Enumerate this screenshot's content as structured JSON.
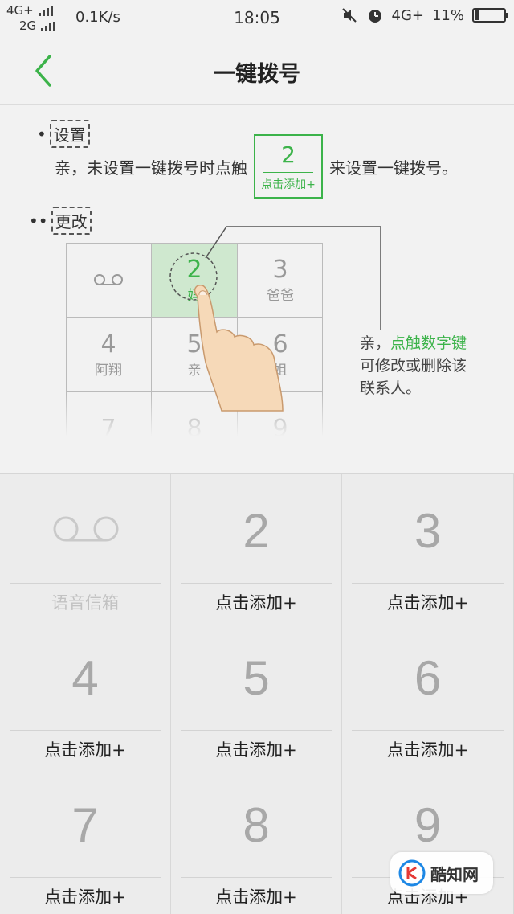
{
  "status_bar": {
    "net1": "4G+",
    "net2": "2G",
    "speed": "0.1K/s",
    "time": "18:05",
    "net3": "4G+",
    "battery": "11%"
  },
  "header": {
    "title": "一键拨号"
  },
  "guide": {
    "setup_label": "设置",
    "setup_text_before": "亲，未设置一键拨号时点触",
    "setup_text_after": "来设置一键拨号。",
    "demo_key_number": "2",
    "demo_key_label": "点击添加+",
    "change_label": "更改",
    "mini_keys": [
      {
        "n": "",
        "s": ""
      },
      {
        "n": "2",
        "s": "妈"
      },
      {
        "n": "3",
        "s": "爸爸"
      },
      {
        "n": "4",
        "s": "阿翔"
      },
      {
        "n": "5",
        "s": "亲"
      },
      {
        "n": "6",
        "s": "姐"
      },
      {
        "n": "7",
        "s": ""
      },
      {
        "n": "8",
        "s": ""
      },
      {
        "n": "9",
        "s": ""
      }
    ],
    "tip_part1": "亲，",
    "tip_highlight": "点触数字键",
    "tip_part2": "可修改或删除该联系人。"
  },
  "keypad": {
    "keys": [
      {
        "digit": "",
        "label": "语音信箱"
      },
      {
        "digit": "2",
        "label": "点击添加+"
      },
      {
        "digit": "3",
        "label": "点击添加+"
      },
      {
        "digit": "4",
        "label": "点击添加+"
      },
      {
        "digit": "5",
        "label": "点击添加+"
      },
      {
        "digit": "6",
        "label": "点击添加+"
      },
      {
        "digit": "7",
        "label": "点击添加+"
      },
      {
        "digit": "8",
        "label": "点击添加+"
      },
      {
        "digit": "9",
        "label": "点击添加+"
      }
    ]
  },
  "watermark": {
    "text": "酷知网"
  },
  "colors": {
    "accent": "#3cb34a",
    "background": "#f2f2f2",
    "key_digit": "#a8a8a8"
  }
}
